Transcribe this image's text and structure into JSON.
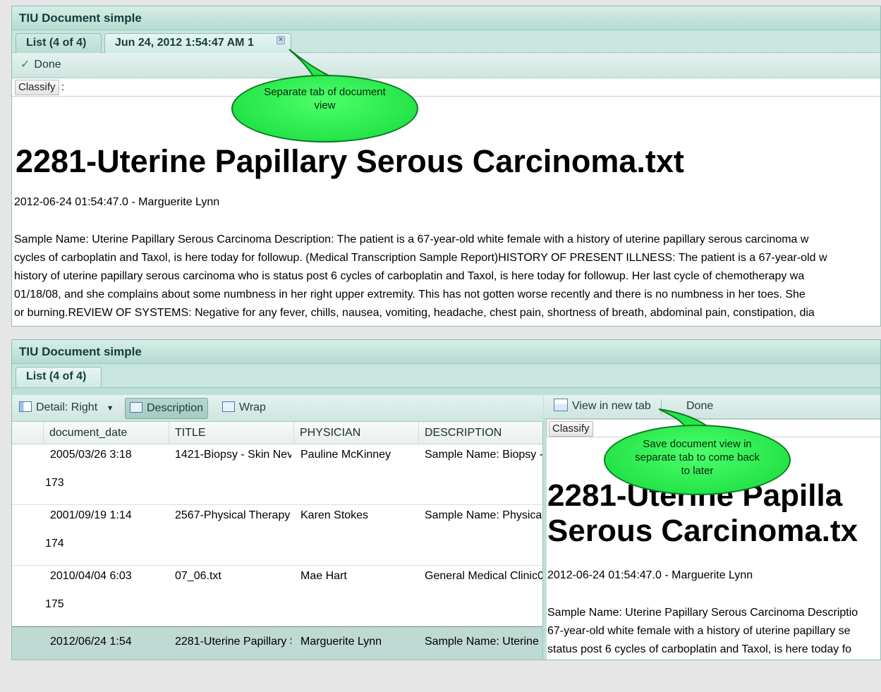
{
  "top": {
    "header": "TIU Document simple",
    "tabs": [
      "List (4 of 4)",
      "Jun 24, 2012 1:54:47 AM 1"
    ],
    "done_label": "Done",
    "classify_label": "Classify",
    "classify_value": ":",
    "doc_title": "2281-Uterine Papillary Serous Carcinoma.txt",
    "doc_meta": "2012-06-24 01:54:47.0 - Marguerite Lynn",
    "doc_body": [
      "Sample Name: Uterine Papillary Serous Carcinoma Description: The patient is a 67-year-old white female with a history of uterine papillary serous carcinoma w",
      "cycles of carboplatin and Taxol, is here today for followup. (Medical Transcription Sample Report)HISTORY OF PRESENT ILLNESS: The patient is a 67-year-old w",
      "history of uterine papillary serous carcinoma who is status post 6 cycles of carboplatin and Taxol, is here today for followup. Her last cycle of chemotherapy wa",
      "01/18/08, and she complains about some numbness in her right upper extremity. This has not gotten worse recently and there is no numbness in her toes. She",
      "or burning.REVIEW OF SYSTEMS: Negative for any fever, chills, nausea, vomiting, headache, chest pain, shortness of breath, abdominal pain, constipation, dia"
    ],
    "callout": "Separate tab of document view"
  },
  "bottom": {
    "header": "TIU Document simple",
    "tab": "List (4 of 4)",
    "toolbar": {
      "detail_label": "Detail: Right",
      "description_label": "Description",
      "wrap_label": "Wrap",
      "view_new_tab_label": "View in new tab",
      "done_label": "Done"
    },
    "columns": [
      "document_date",
      "TITLE",
      "PHYSICIAN",
      "DESCRIPTION"
    ],
    "rows": [
      {
        "date": "2005/03/26 3:18",
        "title": "1421-Biopsy - Skin Nevu",
        "physician": "Pauline McKinney",
        "description": "Sample Name: Biopsy -",
        "id": "173"
      },
      {
        "date": "2001/09/19 1:14",
        "title": "2567-Physical Therapy -",
        "physician": "Karen Stokes",
        "description": "Sample Name: Physical",
        "id": "174"
      },
      {
        "date": "2010/04/04 6:03",
        "title": "07_06.txt",
        "physician": "Mae Hart",
        "description": "General Medical Clinic0",
        "id": "175"
      },
      {
        "date": "2012/06/24 1:54",
        "title": "2281-Uterine Papillary S",
        "physician": "Marguerite Lynn",
        "description": "Sample Name: Uterine",
        "id": ""
      }
    ],
    "detail": {
      "classify_label": "Classify",
      "title_line1": "2281-Uterine Papilla",
      "title_line2": "Serous Carcinoma.tx",
      "meta": "2012-06-24 01:54:47.0 - Marguerite Lynn",
      "body": [
        "Sample Name: Uterine Papillary Serous Carcinoma Descriptio",
        "67-year-old white female with a history of uterine papillary se",
        "status post 6 cycles of carboplatin and Taxol, is here today fo"
      ]
    },
    "callout": "Save document view in separate tab to come back to later"
  },
  "colors": {
    "panel": "#bfe0d8",
    "header_text": "#153b3a",
    "callout": "#22e84a"
  }
}
